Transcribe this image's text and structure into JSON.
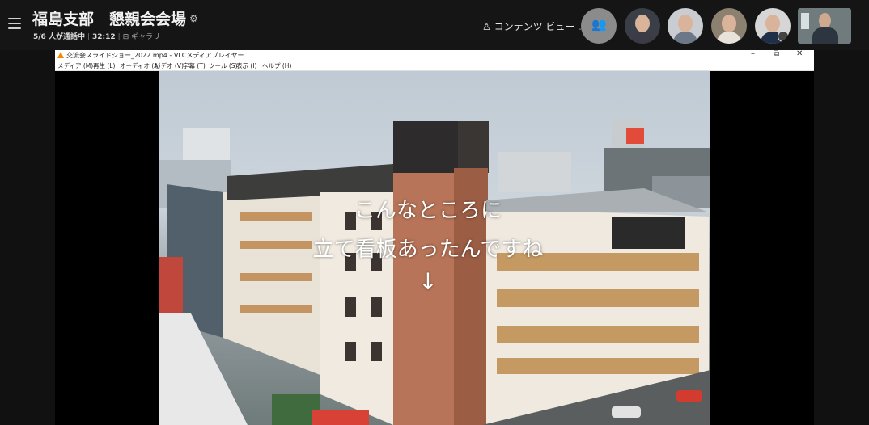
{
  "meeting": {
    "title": "福島支部　懇親会会場",
    "settings_icon": "gear-icon",
    "participants_status": "5/6 人が通話中",
    "elapsed": "32:12",
    "view_icon": "gallery-icon",
    "view_label": "ギャラリー",
    "content_view_label": "コンテンツ ビュー",
    "content_view_icon": "person-pin-icon",
    "chevron": "chevron-down-icon"
  },
  "participants": [
    {
      "name": "participant-gray-avatar",
      "icon": "people-icon"
    },
    {
      "name": "participant-video-1"
    },
    {
      "name": "participant-video-2"
    },
    {
      "name": "participant-video-3"
    },
    {
      "name": "participant-video-4"
    },
    {
      "name": "participant-video-5"
    }
  ],
  "vlc": {
    "window_title": "交流会スライドショー_2022.mp4 - VLCメディアプレイヤー",
    "controls": {
      "minimize": "–",
      "maximize": "⧉",
      "close": "✕"
    },
    "menu": [
      "メディア (M)",
      "再生 (L)",
      "オーディオ (A)",
      "ビデオ (V)",
      "字幕 (T)",
      "ツール (S)",
      "表示 (I)",
      "ヘルプ (H)"
    ]
  },
  "video": {
    "caption_line1": "こんなところに",
    "caption_line2": "立て看板あったんですね",
    "caption_arrow": "↓"
  },
  "colors": {
    "bar_bg": "#151515",
    "vlc_accent": "#f18a00"
  }
}
